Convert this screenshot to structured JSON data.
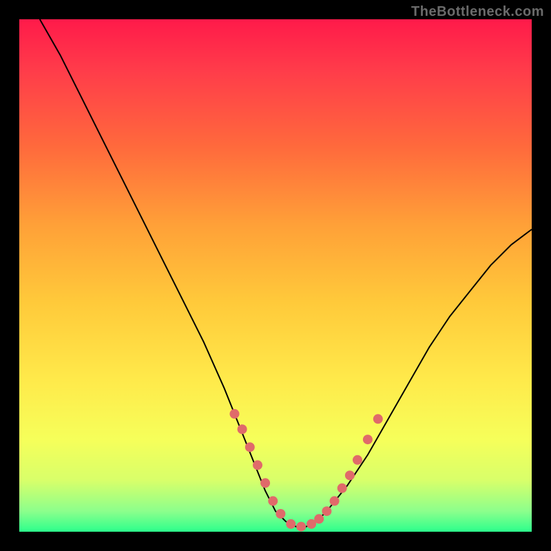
{
  "watermark": "TheBottleneck.com",
  "chart_data": {
    "type": "line",
    "title": "",
    "xlabel": "",
    "ylabel": "",
    "xlim": [
      0,
      100
    ],
    "ylim": [
      0,
      100
    ],
    "series": [
      {
        "name": "curve",
        "x": [
          4,
          8,
          12,
          16,
          20,
          24,
          28,
          32,
          36,
          40,
          42,
          44,
          46,
          48,
          50,
          52,
          54,
          56,
          58,
          60,
          64,
          68,
          72,
          76,
          80,
          84,
          88,
          92,
          96,
          100
        ],
        "y": [
          100,
          93,
          85,
          77,
          69,
          61,
          53,
          45,
          37,
          28,
          23,
          18,
          13,
          8,
          4,
          2,
          1,
          1,
          2,
          4,
          9,
          15,
          22,
          29,
          36,
          42,
          47,
          52,
          56,
          59
        ]
      }
    ],
    "markers": {
      "name": "highlight-dots",
      "color": "#e06a6a",
      "x": [
        42,
        43.5,
        45,
        46.5,
        48,
        49.5,
        51,
        53,
        55,
        57,
        58.5,
        60,
        61.5,
        63,
        64.5,
        66,
        68,
        70
      ],
      "y": [
        23,
        20,
        16.5,
        13,
        9.5,
        6,
        3.5,
        1.5,
        1,
        1.5,
        2.5,
        4,
        6,
        8.5,
        11,
        14,
        18,
        22
      ]
    }
  }
}
